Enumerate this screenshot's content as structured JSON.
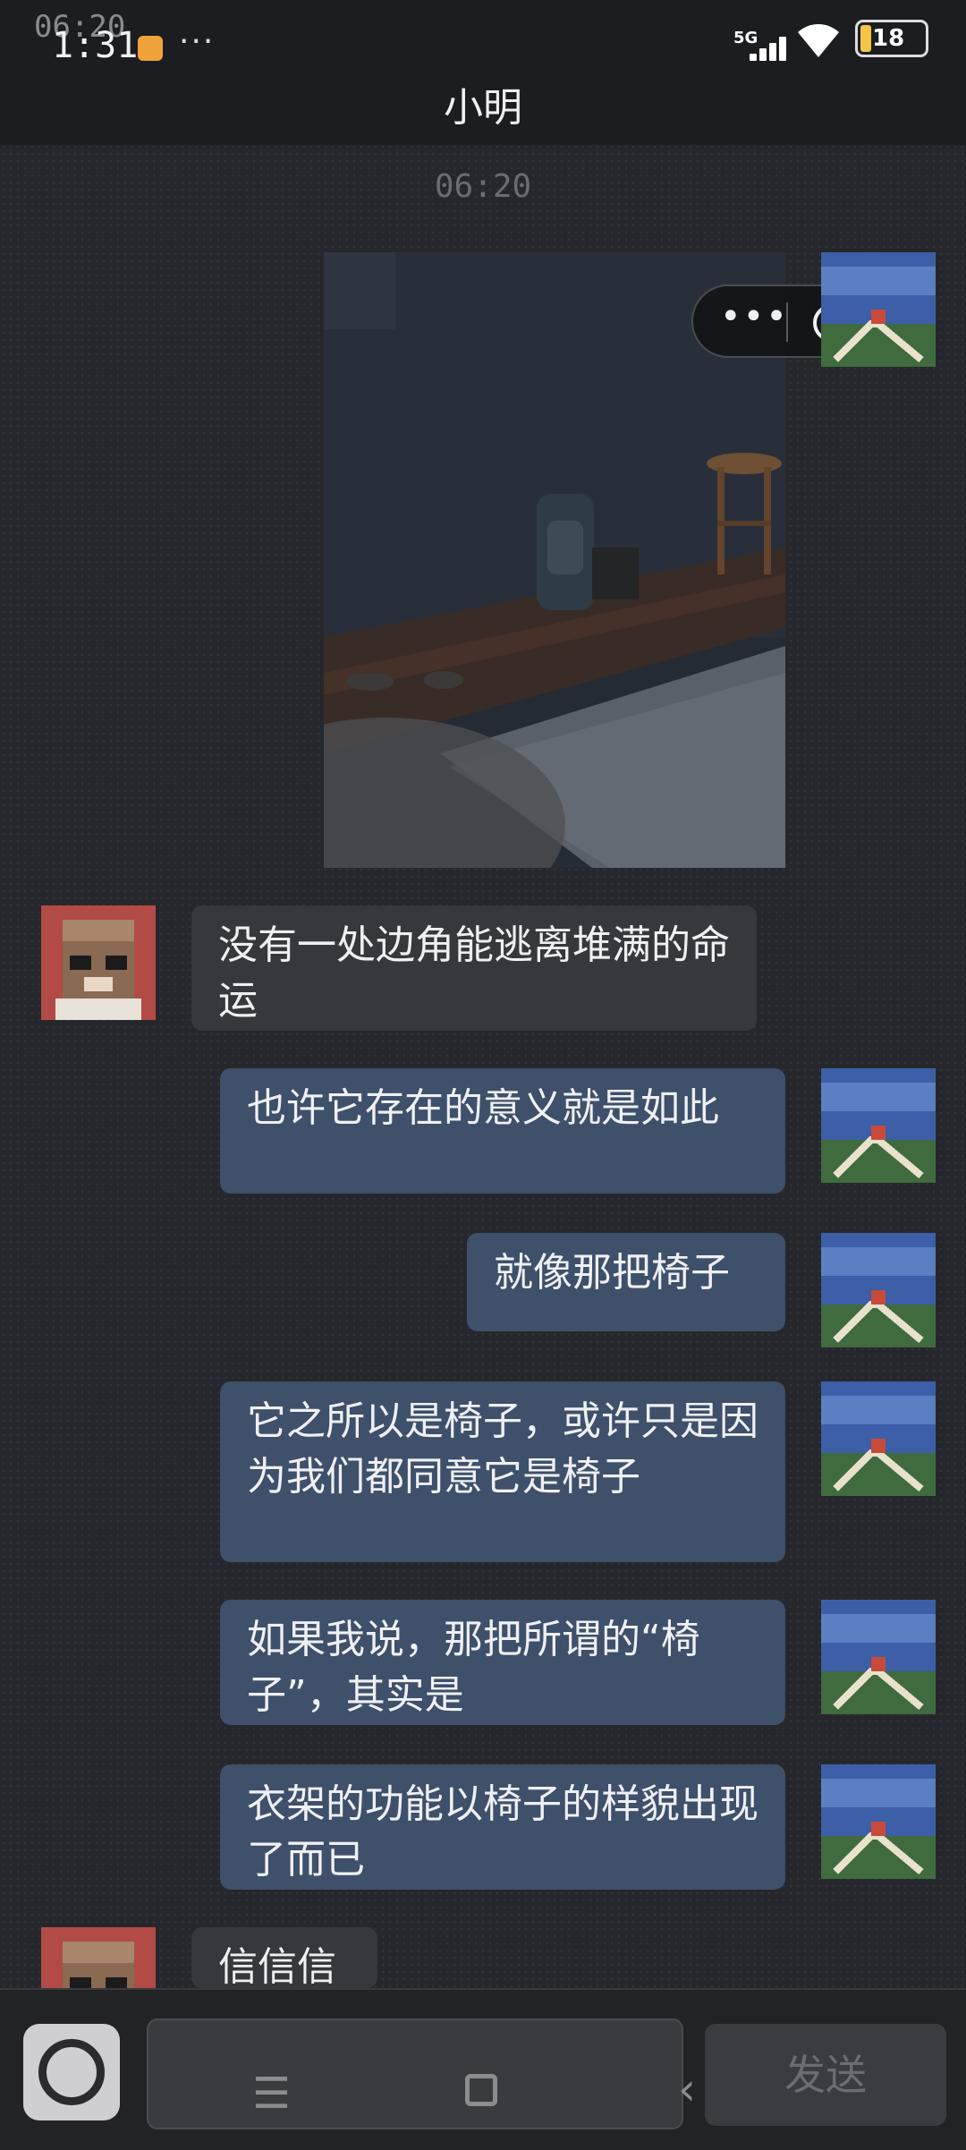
{
  "status_bar": {
    "time": "1:31",
    "time_overlay": "06:20",
    "more_indicator": "···",
    "network": "5G",
    "battery_level": "18"
  },
  "chat": {
    "title": "小明",
    "timestamp": "06:20"
  },
  "messages": [
    {
      "side": "right",
      "type": "image",
      "avatar": "pixel-landscape"
    },
    {
      "side": "left",
      "type": "text",
      "text": "没有一处边角能逃离堆满的命运",
      "avatar": "pixel-owl"
    },
    {
      "side": "right",
      "type": "text",
      "text": "也许它存在的意义就是如此",
      "avatar": "pixel-landscape"
    },
    {
      "side": "right",
      "type": "text",
      "text": "就像那把椅子",
      "avatar": "pixel-landscape"
    },
    {
      "side": "right",
      "type": "text",
      "text": "它之所以是椅子，或许只是因为我们都同意它是椅子",
      "avatar": "pixel-landscape"
    },
    {
      "side": "right",
      "type": "text",
      "text": "如果我说，那把所谓的“椅子”，其实是",
      "avatar": "pixel-landscape"
    },
    {
      "side": "right",
      "type": "text",
      "text": "衣架的功能以椅子的样貌出现了而已",
      "avatar": "pixel-landscape"
    },
    {
      "side": "left",
      "type": "text",
      "text": "信信信",
      "avatar": "pixel-owl"
    }
  ],
  "input": {
    "send_label": "发送"
  },
  "colors": {
    "background": "#26272c",
    "bubble_right": "#3e506a",
    "bubble_left": "#37383d"
  }
}
